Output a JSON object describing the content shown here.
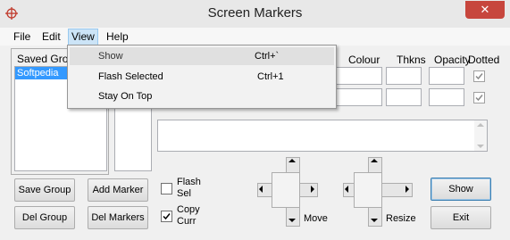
{
  "window": {
    "title": "Screen Markers",
    "close_glyph": "✕"
  },
  "menubar": [
    "File",
    "Edit",
    "View",
    "Help"
  ],
  "view_menu": [
    {
      "label": "Show",
      "shortcut": "Ctrl+`",
      "highlighted": true
    },
    {
      "label": "Flash Selected",
      "shortcut": "Ctrl+1"
    },
    {
      "label": "Stay On Top",
      "shortcut": ""
    }
  ],
  "saved_groups": {
    "label": "Saved Grou",
    "items": [
      "Softpedia"
    ]
  },
  "columns": {
    "colour": "Colour",
    "thkns": "Thkns",
    "opacity": "Opacity",
    "dotted": "Dotted"
  },
  "buttons": {
    "save_group": "Save Group",
    "add_marker": "Add Marker",
    "del_group": "Del Group",
    "del_markers": "Del Markers",
    "show": "Show",
    "exit": "Exit"
  },
  "checkboxes": {
    "flash_sel": {
      "line1": "Flash",
      "line2": "Sel",
      "checked": false
    },
    "copy_curr": {
      "line1": "Copy",
      "line2": "Curr",
      "checked": true
    },
    "dotted_row1": {
      "checked": true
    },
    "dotted_row2": {
      "checked": true
    }
  },
  "controls": {
    "move": "Move",
    "resize": "Resize"
  },
  "colors": {
    "accent": "#cce4f7",
    "close": "#c7463d"
  }
}
